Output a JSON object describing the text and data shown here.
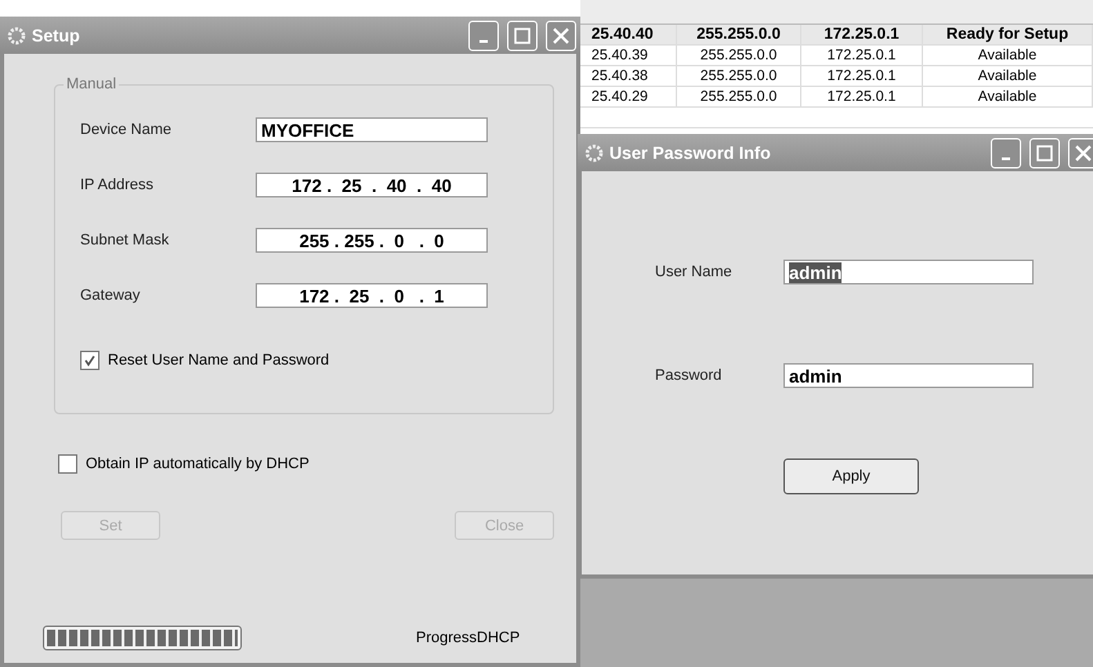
{
  "setup_window": {
    "title": "Setup",
    "group_label": "Manual",
    "fields": [
      {
        "label": "Device Name",
        "value": "MYOFFICE",
        "kind": "text"
      },
      {
        "label": "IP Address",
        "value": "172 .  25  .  40  .  40",
        "kind": "ip"
      },
      {
        "label": "Subnet Mask",
        "value": "255 . 255 .  0   .  0",
        "kind": "ip"
      },
      {
        "label": "Gateway",
        "value": "172 .  25  .  0   .  1",
        "kind": "ip"
      }
    ],
    "reset_checkbox": {
      "label": "Reset User Name and Password",
      "checked": true
    },
    "dhcp_checkbox": {
      "label": "Obtain IP automatically by DHCP",
      "checked": false
    },
    "buttons": [
      {
        "label": "Set",
        "disabled": true
      },
      {
        "label": "Close",
        "disabled": true
      }
    ],
    "progress": {
      "level": 1,
      "label": "ProgressDHCP"
    }
  },
  "device_table": {
    "rows": [
      {
        "cells": [
          "25.40.40",
          "255.255.0.0",
          "172.25.0.1",
          "Ready for Setup"
        ],
        "selected": true
      },
      {
        "cells": [
          "25.40.39",
          "255.255.0.0",
          "172.25.0.1",
          "Available"
        ],
        "selected": false
      },
      {
        "cells": [
          "25.40.38",
          "255.255.0.0",
          "172.25.0.1",
          "Available"
        ],
        "selected": false
      },
      {
        "cells": [
          "25.40.29",
          "255.255.0.0",
          "172.25.0.1",
          "Available"
        ],
        "selected": false
      }
    ]
  },
  "password_window": {
    "title": "User Password Info",
    "fields": [
      {
        "label": "User Name",
        "value": "admin",
        "selected": true
      },
      {
        "label": "Password",
        "value": "admin",
        "selected": false
      }
    ],
    "button": "Apply"
  }
}
